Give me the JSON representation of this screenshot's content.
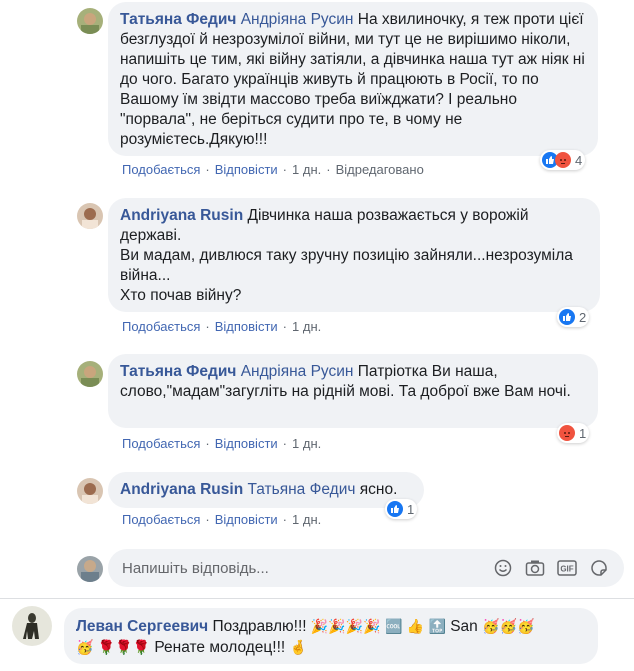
{
  "comments": [
    {
      "author": "Татьяна Федич",
      "mention": "Андріяна Русин",
      "text": "На хвилиночку, я теж проти цієї безглуздої й незрозумілої війни, ми тут це не вирішимо ніколи, напишіть це тим, які війну затіяли, а дівчинка наша тут аж ніяк ні до чого. Багато українців живуть й працюють в Росії, то по Вашому їм звідти массово треба виїжджати? І реально \"порвала\", не беріться судити про те, в чому не розумієтесь.Дякую!!!",
      "like": "Подобається",
      "reply": "Відповісти",
      "time": "1 дн.",
      "edited": "Відредаговано",
      "reaction_count": "4"
    },
    {
      "author": "Andriyana Rusin",
      "line1": "Дівчинка наша розважається у ворожій державі.",
      "line2": "Ви мадам, дивлюся таку зручну позицію зайняли...незрозуміла війна...",
      "line3": "Хто почав війну?",
      "like": "Подобається",
      "reply": "Відповісти",
      "time": "1 дн.",
      "reaction_count": "2"
    },
    {
      "author": "Татьяна Федич",
      "mention": "Андріяна Русин",
      "text": "Патріотка Ви наша, слово,\"мадам\"загугліть на рідній мові. Та доброї вже Вам ночі.",
      "like": "Подобається",
      "reply": "Відповісти",
      "time": "1 дн.",
      "reaction_count": "1"
    },
    {
      "author": "Andriyana Rusin",
      "mention": "Татьяна Федич",
      "text": "ясно.",
      "like": "Подобається",
      "reply": "Відповісти",
      "time": "1 дн.",
      "reaction_count": "1"
    }
  ],
  "reply_box": {
    "placeholder": "Напишіть відповідь..."
  },
  "bottom_comment": {
    "author": "Леван Сергеевич",
    "text1": "Поздравлю!!!",
    "text_san": "San",
    "text2": "Ренате молодец!!!"
  },
  "colors": {
    "link": "#385898",
    "bubble": "#f0f2f5",
    "like_blue": "#1877f2",
    "angry": "#f0533f"
  }
}
